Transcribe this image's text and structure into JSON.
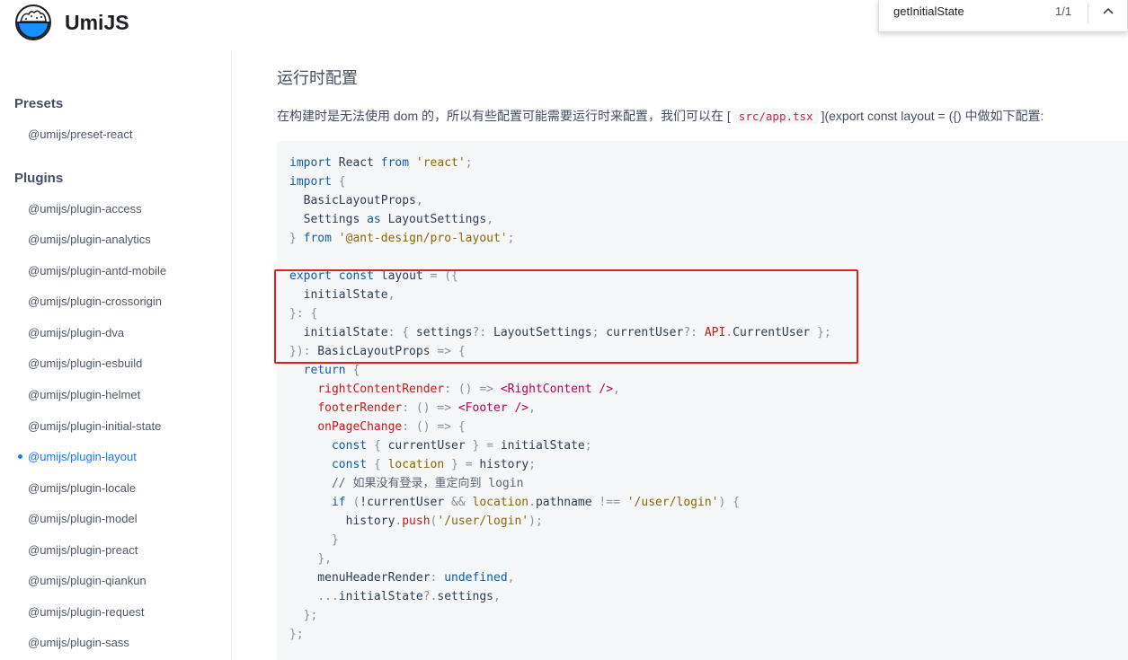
{
  "header": {
    "brand": "UmiJS",
    "logo_icon": "rice-bowl-icon"
  },
  "findbar": {
    "query": "getInitialState",
    "count": "1/1",
    "up_icon": "chevron-up-icon"
  },
  "sidebar": {
    "sections": [
      {
        "title": "Presets",
        "items": [
          "@umijs/preset-react"
        ]
      },
      {
        "title": "Plugins",
        "items": [
          "@umijs/plugin-access",
          "@umijs/plugin-analytics",
          "@umijs/plugin-antd-mobile",
          "@umijs/plugin-crossorigin",
          "@umijs/plugin-dva",
          "@umijs/plugin-esbuild",
          "@umijs/plugin-helmet",
          "@umijs/plugin-initial-state",
          "@umijs/plugin-layout",
          "@umijs/plugin-locale",
          "@umijs/plugin-model",
          "@umijs/plugin-preact",
          "@umijs/plugin-qiankun",
          "@umijs/plugin-request",
          "@umijs/plugin-sass"
        ]
      }
    ],
    "active_item": "@umijs/plugin-layout"
  },
  "content": {
    "title": "运行时配置",
    "desc_before": "在构建时是无法使用 dom 的，所以有些配置可能需要运行时来配置，我们可以在 [",
    "desc_code": "src/app.tsx",
    "desc_after": "](export const layout = ({) 中做如下配置:",
    "code_lines": [
      "import React from 'react';",
      "import {",
      "  BasicLayoutProps,",
      "  Settings as LayoutSettings,",
      "} from '@ant-design/pro-layout';",
      "",
      "export const layout = ({",
      "  initialState,",
      "}: {",
      "  initialState: { settings?: LayoutSettings; currentUser?: API.CurrentUser };",
      "}): BasicLayoutProps => {",
      "  return {",
      "    rightContentRender: () => <RightContent />,",
      "    footerRender: () => <Footer />,",
      "    onPageChange: () => {",
      "      const { currentUser } = initialState;",
      "      const { location } = history;",
      "      // 如果没有登录，重定向到 login",
      "      if (!currentUser && location.pathname !== '/user/login') {",
      "        history.push('/user/login');",
      "      }",
      "    },",
      "    menuHeaderRender: undefined,",
      "    ...initialState?.settings,",
      "  };",
      "};"
    ]
  },
  "colors": {
    "accent": "#1677ff",
    "highlight": "#e02020",
    "code_bg": "#f6f7f9"
  }
}
